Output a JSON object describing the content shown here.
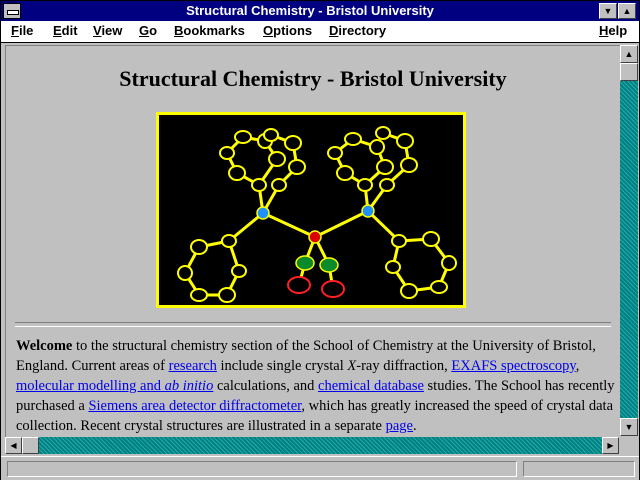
{
  "window": {
    "title": "Structural Chemistry - Bristol University"
  },
  "menu": {
    "items": [
      "File",
      "Edit",
      "View",
      "Go",
      "Bookmarks",
      "Options",
      "Directory"
    ],
    "help": "Help"
  },
  "page": {
    "heading": "Structural Chemistry - Bristol University",
    "image_alt": "molecular structure",
    "para": {
      "welcome": "Welcome",
      "t1": " to the structural chemistry section of the School of Chemistry at the University of Bristol, England. Current areas of ",
      "link_research": "research",
      "t2": " include single crystal ",
      "x_italic": "X",
      "t3": "-ray diffraction, ",
      "link_exafs": "EXAFS spectroscopy",
      "t4": ", ",
      "link_mm_a": "molecular modelling and ",
      "link_mm_b": "ab initio",
      "t5": " calculations, and ",
      "link_db": "chemical database",
      "t6": " studies. The School has recently purchased a ",
      "link_siemens": "Siemens area detector diffractometer",
      "t7": ", which has greatly increased the speed of crystal data collection. Recent crystal structures are illustrated in a separate ",
      "link_page": "page",
      "t8": "."
    }
  },
  "colors": {
    "titlebar": "#000080",
    "link": "#0000ee",
    "scroll_track": "#008080",
    "molecule_frame": "#ffff00"
  }
}
